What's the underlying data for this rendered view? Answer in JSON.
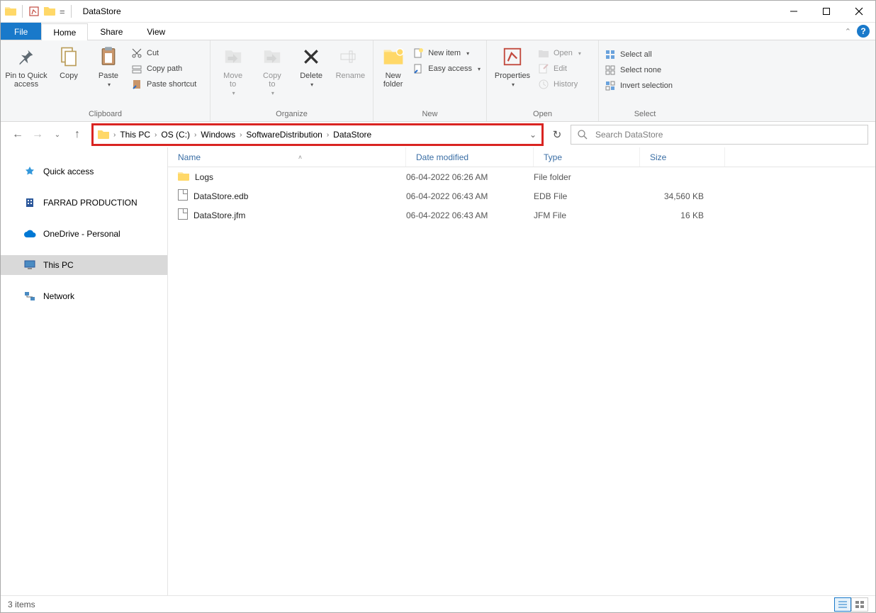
{
  "window": {
    "title": "DataStore"
  },
  "tabs": {
    "file": "File",
    "home": "Home",
    "share": "Share",
    "view": "View"
  },
  "ribbon": {
    "clipboard": {
      "label": "Clipboard",
      "pin": "Pin to Quick\naccess",
      "copy": "Copy",
      "paste": "Paste",
      "cut": "Cut",
      "copy_path": "Copy path",
      "paste_shortcut": "Paste shortcut"
    },
    "organize": {
      "label": "Organize",
      "move_to": "Move\nto",
      "copy_to": "Copy\nto",
      "delete": "Delete",
      "rename": "Rename"
    },
    "new": {
      "label": "New",
      "new_folder": "New\nfolder",
      "new_item": "New item",
      "easy_access": "Easy access"
    },
    "open": {
      "label": "Open",
      "properties": "Properties",
      "open": "Open",
      "edit": "Edit",
      "history": "History"
    },
    "select": {
      "label": "Select",
      "select_all": "Select all",
      "select_none": "Select none",
      "invert": "Invert selection"
    }
  },
  "breadcrumbs": [
    "This PC",
    "OS (C:)",
    "Windows",
    "SoftwareDistribution",
    "DataStore"
  ],
  "search": {
    "placeholder": "Search DataStore"
  },
  "nav": {
    "quick_access": "Quick access",
    "farrad": "FARRAD PRODUCTION",
    "onedrive": "OneDrive - Personal",
    "this_pc": "This PC",
    "network": "Network"
  },
  "columns": {
    "name": "Name",
    "date": "Date modified",
    "type": "Type",
    "size": "Size"
  },
  "files": [
    {
      "icon": "folder",
      "name": "Logs",
      "date": "06-04-2022 06:26 AM",
      "type": "File folder",
      "size": ""
    },
    {
      "icon": "file",
      "name": "DataStore.edb",
      "date": "06-04-2022 06:43 AM",
      "type": "EDB File",
      "size": "34,560 KB"
    },
    {
      "icon": "file",
      "name": "DataStore.jfm",
      "date": "06-04-2022 06:43 AM",
      "type": "JFM File",
      "size": "16 KB"
    }
  ],
  "status": {
    "count": "3 items"
  }
}
